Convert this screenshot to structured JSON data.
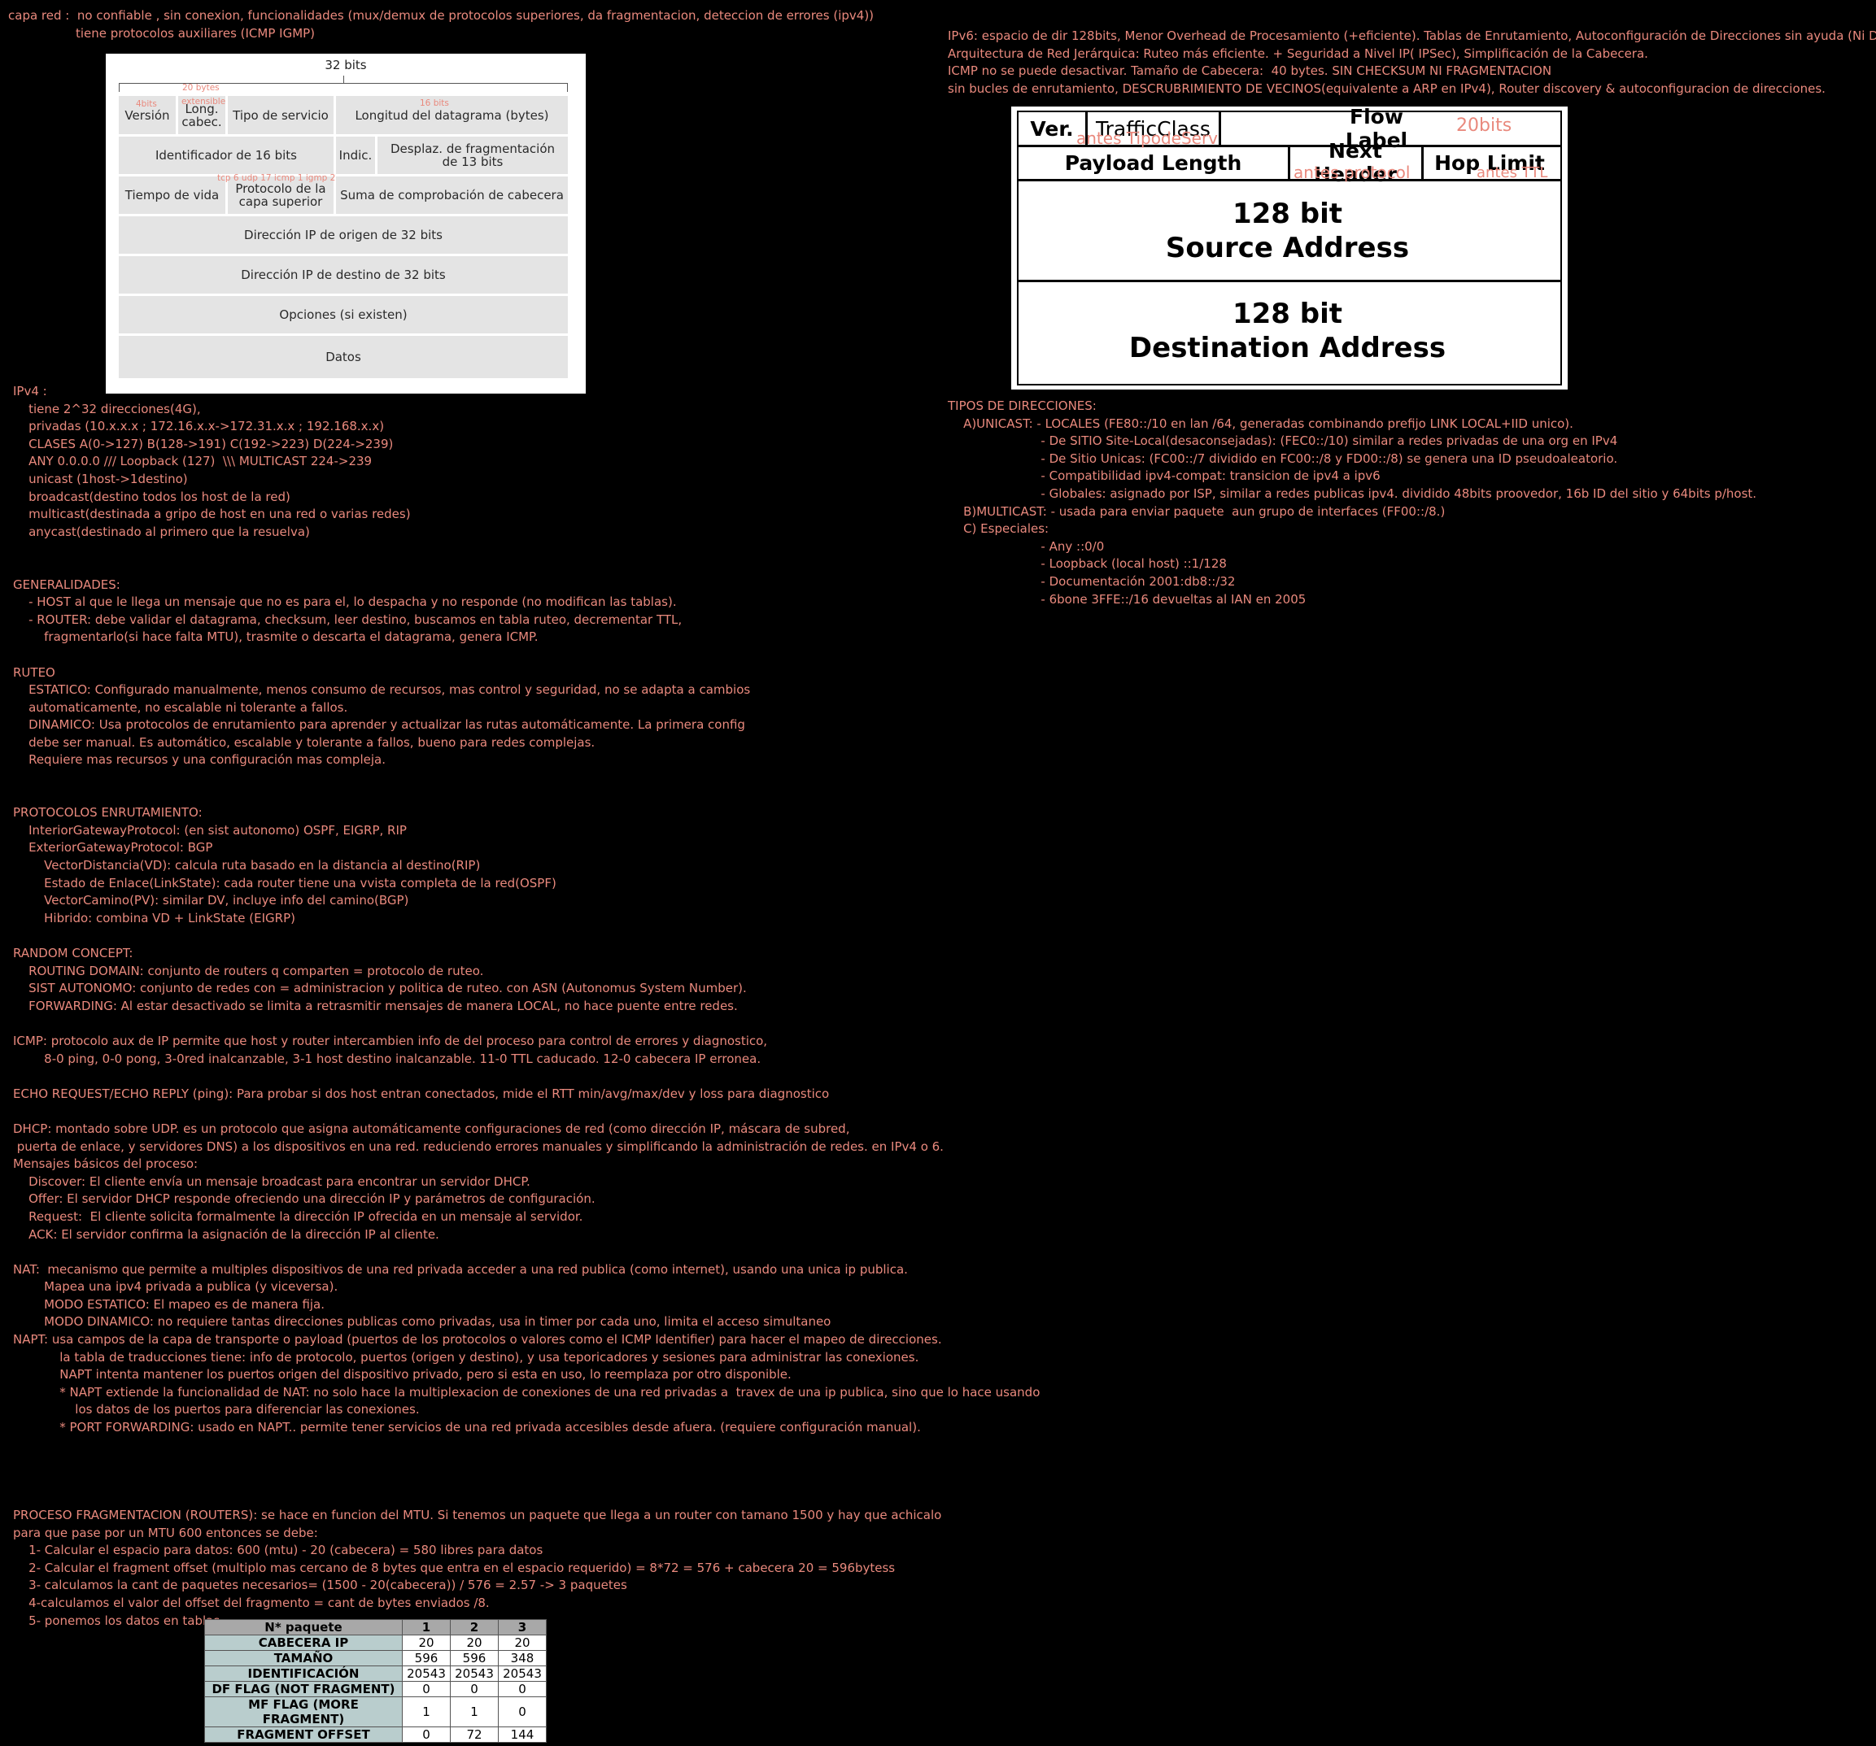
{
  "top_left": {
    "line1": "capa red :  no confiable , sin conexion, funcionalidades (mux/demux de protocolos superiores, da fragmentacion, deteccion de errores (ipv4))",
    "line2": "tiene protocolos auxiliares (ICMP IGMP)"
  },
  "ipv4_figure": {
    "bits": "32 bits",
    "version": "Versión",
    "hlen": "Long.\ncabec.",
    "tos": "Tipo de servicio",
    "total_len": "Longitud del datagrama (bytes)",
    "id": "Identificador de 16 bits",
    "flags": "Indic.",
    "frag_off": "Desplaz. de fragmentación\nde 13 bits",
    "ttl": "Tiempo de vida",
    "protocol": "Protocolo de la\ncapa superior",
    "checksum": "Suma de comprobación de cabecera",
    "src": "Dirección IP de origen de 32 bits",
    "dst": "Dirección IP de destino de 32 bits",
    "options": "Opciones (si existen)",
    "data": "Datos",
    "notes": {
      "n4bits": "4bits",
      "n20bytes": "20 bytes",
      "nextensible": "extensible",
      "n16bits": "16 bits",
      "nproto": "tcp 6  udp 17  icmp 1 igmp 2"
    }
  },
  "ipv6_figure": {
    "ver": "Ver.",
    "traffic_class": "TrafficClass",
    "flow_label": "Flow Label",
    "note_20bits": "20bits",
    "note_tos": "antes TipodeServ",
    "payload_length": "Payload Length",
    "next_header": "Next Header",
    "note_proto": "antes protocol",
    "hop_limit": "Hop Limit",
    "note_ttl": "antes TTL",
    "src": "128 bit\nSource Address",
    "dst": "128 bit\nDestination Address"
  },
  "ipv6_text": [
    "IPv6: espacio de dir 128bits, Menor Overhead de Procesamiento (+eficiente). Tablas de Enrutamiento, Autoconfiguración de Direcciones sin ayuda (Ni DHCP).",
    "Arquitectura de Red Jerárquica: Ruteo más eficiente. + Seguridad a Nivel IP( IPSec), Simplificación de la Cabecera.",
    "ICMP no se puede desactivar. Tamaño de Cabecera:  40 bytes. SIN CHECKSUM NI FRAGMENTACION",
    "sin bucles de enrutamiento, DESCRUBRIMIENTO DE VECINOS(equivalente a ARP en IPv4), Router discovery & autoconfiguracion de direcciones."
  ],
  "tipos_text": [
    "TIPOS DE DIRECCIONES:",
    "    A)UNICAST: - LOCALES (FE80::/10 en lan /64, generadas combinando prefijo LINK LOCAL+IID unico).",
    "                        - De SITIO Site-Local(desaconsejadas): (FEC0::/10) similar a redes privadas de una org en IPv4",
    "                        - De Sitio Unicas: (FC00::/7 dividido en FC00::/8 y FD00::/8) se genera una ID pseudoaleatorio.",
    "                        - Compatibilidad ipv4-compat: transicion de ipv4 a ipv6",
    "                        - Globales: asignado por ISP, similar a redes publicas ipv4. dividido 48bits proovedor, 16b ID del sitio y 64bits p/host.",
    "    B)MULTICAST: - usada para enviar paquete  aun grupo de interfaces (FF00::/8.)",
    "    C) Especiales:",
    "                        - Any ::0/0",
    "                        - Loopback (local host) ::1/128",
    "                        - Documentación 2001:db8::/32",
    "                        - 6bone 3FFE::/16 devueltas al IAN en 2005"
  ],
  "left_text": [
    "IPv4 :",
    "    tiene 2^32 direcciones(4G),",
    "    privadas (10.x.x.x ; 172.16.x.x->172.31.x.x ; 192.168.x.x)",
    "    CLASES A(0->127) B(128->191) C(192->223) D(224->239)",
    "    ANY 0.0.0.0 /// Loopback (127)  \\\\\\ MULTICAST 224->239",
    "    unicast (1host->1destino)",
    "    broadcast(destino todos los host de la red)",
    "    multicast(destinada a gripo de host en una red o varias redes)",
    "    anycast(destinado al primero que la resuelva)",
    "",
    "",
    "GENERALIDADES:",
    "    - HOST al que le llega un mensaje que no es para el, lo despacha y no responde (no modifican las tablas).",
    "    - ROUTER: debe validar el datagrama, checksum, leer destino, buscamos en tabla ruteo, decrementar TTL,",
    "        fragmentarlo(si hace falta MTU), trasmite o descarta el datagrama, genera ICMP.",
    "",
    "RUTEO",
    "    ESTATICO: Configurado manualmente, menos consumo de recursos, mas control y seguridad, no se adapta a cambios",
    "    automaticamente, no escalable ni tolerante a fallos.",
    "    DINAMICO: Usa protocolos de enrutamiento para aprender y actualizar las rutas automáticamente. La primera config",
    "    debe ser manual. Es automático, escalable y tolerante a fallos, bueno para redes complejas.",
    "    Requiere mas recursos y una configuración mas compleja.",
    "",
    "",
    "PROTOCOLOS ENRUTAMIENTO:",
    "    InteriorGatewayProtocol: (en sist autonomo) OSPF, EIGRP, RIP",
    "    ExteriorGatewayProtocol: BGP",
    "        VectorDistancia(VD): calcula ruta basado en la distancia al destino(RIP)",
    "        Estado de Enlace(LinkState): cada router tiene una vvista completa de la red(OSPF)",
    "        VectorCamino(PV): similar DV, incluye info del camino(BGP)",
    "        Hibrido: combina VD + LinkState (EIGRP)",
    "",
    "RANDOM CONCEPT:",
    "    ROUTING DOMAIN: conjunto de routers q comparten = protocolo de ruteo.",
    "    SIST AUTONOMO: conjunto de redes con = administracion y politica de ruteo. con ASN (Autonomus System Number).",
    "    FORWARDING: Al estar desactivado se limita a retrasmitir mensajes de manera LOCAL, no hace puente entre redes.",
    "",
    "ICMP: protocolo aux de IP permite que host y router intercambien info de del proceso para control de errores y diagnostico,",
    "        8-0 ping, 0-0 pong, 3-0red inalcanzable, 3-1 host destino inalcanzable. 11-0 TTL caducado. 12-0 cabecera IP erronea.",
    "",
    "ECHO REQUEST/ECHO REPLY (ping): Para probar si dos host entran conectados, mide el RTT min/avg/max/dev y loss para diagnostico",
    "",
    "DHCP: montado sobre UDP. es un protocolo que asigna automáticamente configuraciones de red (como dirección IP, máscara de subred,",
    " puerta de enlace, y servidores DNS) a los dispositivos en una red. reduciendo errores manuales y simplificando la administración de redes. en IPv4 o 6.",
    "Mensajes básicos del proceso:",
    "    Discover: El cliente envía un mensaje broadcast para encontrar un servidor DHCP.",
    "    Offer: El servidor DHCP responde ofreciendo una dirección IP y parámetros de configuración.",
    "    Request:  El cliente solicita formalmente la dirección IP ofrecida en un mensaje al servidor.",
    "    ACK: El servidor confirma la asignación de la dirección IP al cliente.",
    "",
    "NAT:  mecanismo que permite a multiples dispositivos de una red privada acceder a una red publica (como internet), usando una unica ip publica.",
    "        Mapea una ipv4 privada a publica (y viceversa).",
    "        MODO ESTATICO: El mapeo es de manera fija.",
    "        MODO DINAMICO: no requiere tantas direcciones publicas como privadas, usa in timer por cada uno, limita el acceso simultaneo",
    "NAPT: usa campos de la capa de transporte o payload (puertos de los protocolos o valores como el ICMP Identifier) para hacer el mapeo de direcciones.",
    "            la tabla de traducciones tiene: info de protocolo, puertos (origen y destino), y usa teporicadores y sesiones para administrar las conexiones.",
    "            NAPT intenta mantener los puertos origen del dispositivo privado, pero si esta en uso, lo reemplaza por otro disponible.",
    "            * NAPT extiende la funcionalidad de NAT: no solo hace la multiplexacion de conexiones de una red privadas a  travex de una ip publica, sino que lo hace usando",
    "                los datos de los puertos para diferenciar las conexiones.",
    "            * PORT FORWARDING: usado en NAPT.. permite tener servicios de una red privada accesibles desde afuera. (requiere configuración manual).",
    "",
    "",
    "",
    "",
    "PROCESO FRAGMENTACION (ROUTERS): se hace en funcion del MTU. Si tenemos un paquete que llega a un router con tamano 1500 y hay que achicalo",
    "para que pase por un MTU 600 entonces se debe:",
    "    1- Calcular el espacio para datos: 600 (mtu) - 20 (cabecera) = 580 libres para datos",
    "    2- Calcular el fragment offset (multiplo mas cercano de 8 bytes que entra en el espacio requerido) = 8*72 = 576 + cabecera 20 = 596bytess",
    "    3- calculamos la cant de paquetes necesarios= (1500 - 20(cabecera)) / 576 = 2.57 -> 3 paquetes",
    "    4-calculamos el valor del offset del fragmento = cant de bytes enviados /8.",
    "    5- ponemos los datos en tablas."
  ],
  "frag_table": {
    "header": [
      "N* paquete",
      "1",
      "2",
      "3"
    ],
    "rows": [
      [
        "CABECERA IP",
        "20",
        "20",
        "20"
      ],
      [
        "TAMAÑO",
        "596",
        "596",
        "348"
      ],
      [
        "IDENTIFICACIÓN",
        "20543",
        "20543",
        "20543"
      ],
      [
        "DF FLAG  (NOT FRAGMENT)",
        "0",
        "0",
        "0"
      ],
      [
        "MF FLAG  (MORE FRAGMENT)",
        "1",
        "1",
        "0"
      ],
      [
        "FRAGMENT OFFSET",
        "0",
        "72",
        "144"
      ]
    ]
  }
}
